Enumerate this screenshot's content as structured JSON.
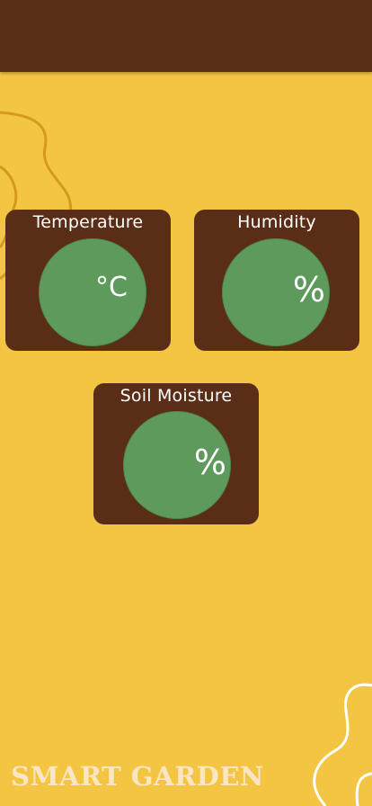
{
  "app": {
    "brand": "SMART GARDEN"
  },
  "sensors": [
    {
      "title": "Temperature",
      "value": "",
      "unit": "°C"
    },
    {
      "title": "Humidity",
      "value": "",
      "unit": "%"
    },
    {
      "title": "Soil Moisture",
      "value": "",
      "unit": "%"
    }
  ],
  "colors": {
    "background": "#f4c543",
    "header": "#5a2e16",
    "card": "#5a2e16",
    "gauge": "#5d9a5c",
    "brand_text": "#fbe6c3",
    "doodle_line": "#d49a1e"
  }
}
